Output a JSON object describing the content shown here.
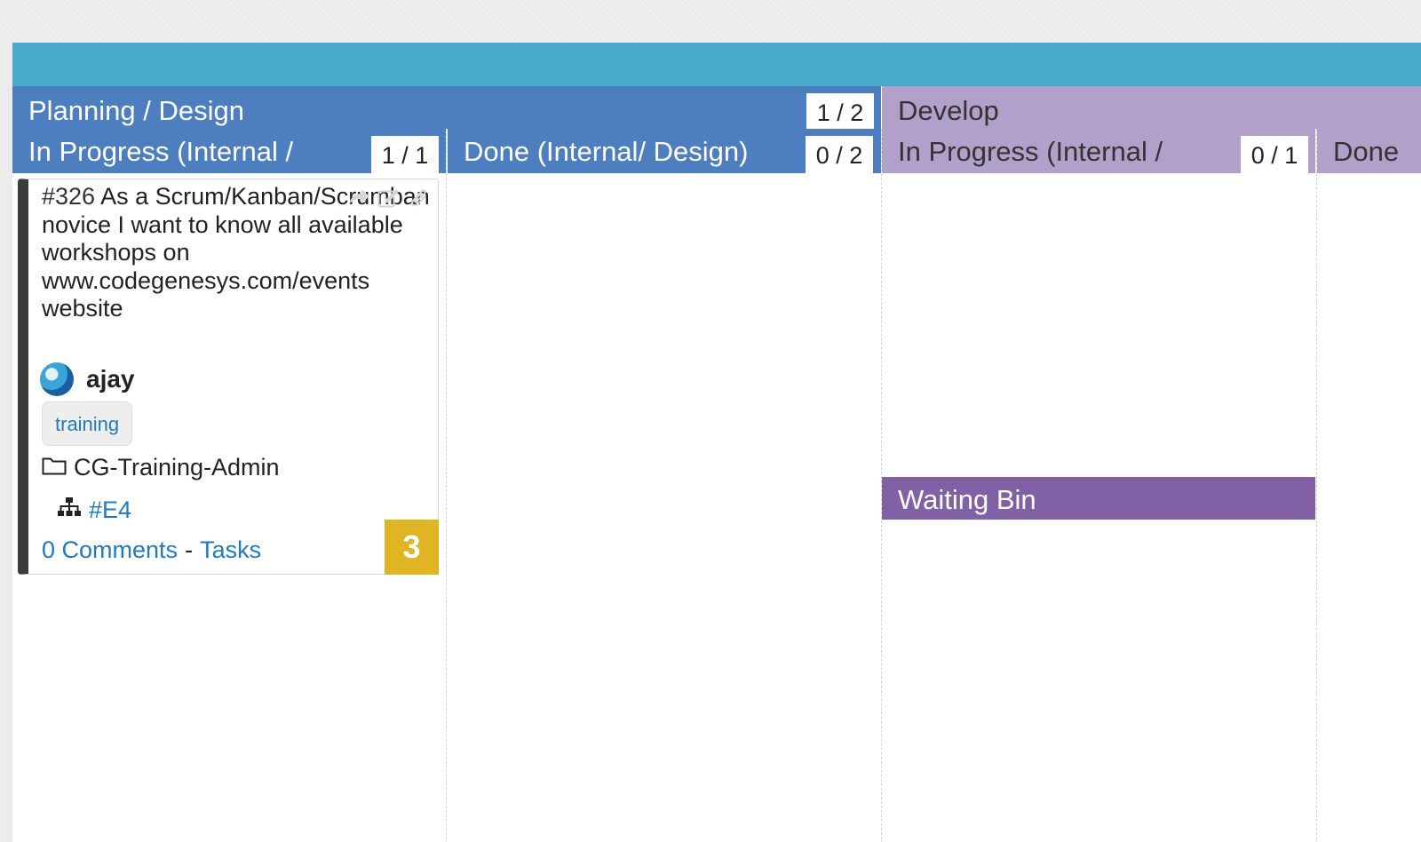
{
  "colors": {
    "top_bar": "#48aacb",
    "planning_group": "#4d7ec0",
    "develop_group": "#b1a0ca",
    "waiting_bin": "#8161a5",
    "story_points": "#e0b523",
    "link": "#1f7ac0"
  },
  "groups": [
    {
      "title": "Planning / Design",
      "count": "1 / 2"
    },
    {
      "title": "Develop",
      "count": ""
    }
  ],
  "columns": [
    {
      "title": "In Progress (Internal /",
      "count": "1 / 1"
    },
    {
      "title": "Done (Internal/ Design)",
      "count": "0 / 2"
    },
    {
      "title": "In Progress (Internal /",
      "count": "0 / 1"
    },
    {
      "title": "Done",
      "count": ""
    }
  ],
  "card": {
    "id": "#326",
    "title": "As a Scrum/Kanban/Scrumban novice I want to know all available workshops on www.codegenesys.com/events website",
    "assignee": "ajay",
    "tag": "training",
    "project": "CG-Training-Admin",
    "epic": "#E4",
    "comments": "0 Comments",
    "separator": "-",
    "tasks": "Tasks",
    "points": "3",
    "icons": [
      "share-icon",
      "edit-icon",
      "paperclip-icon"
    ]
  },
  "swimlane": {
    "title": "Waiting Bin"
  }
}
